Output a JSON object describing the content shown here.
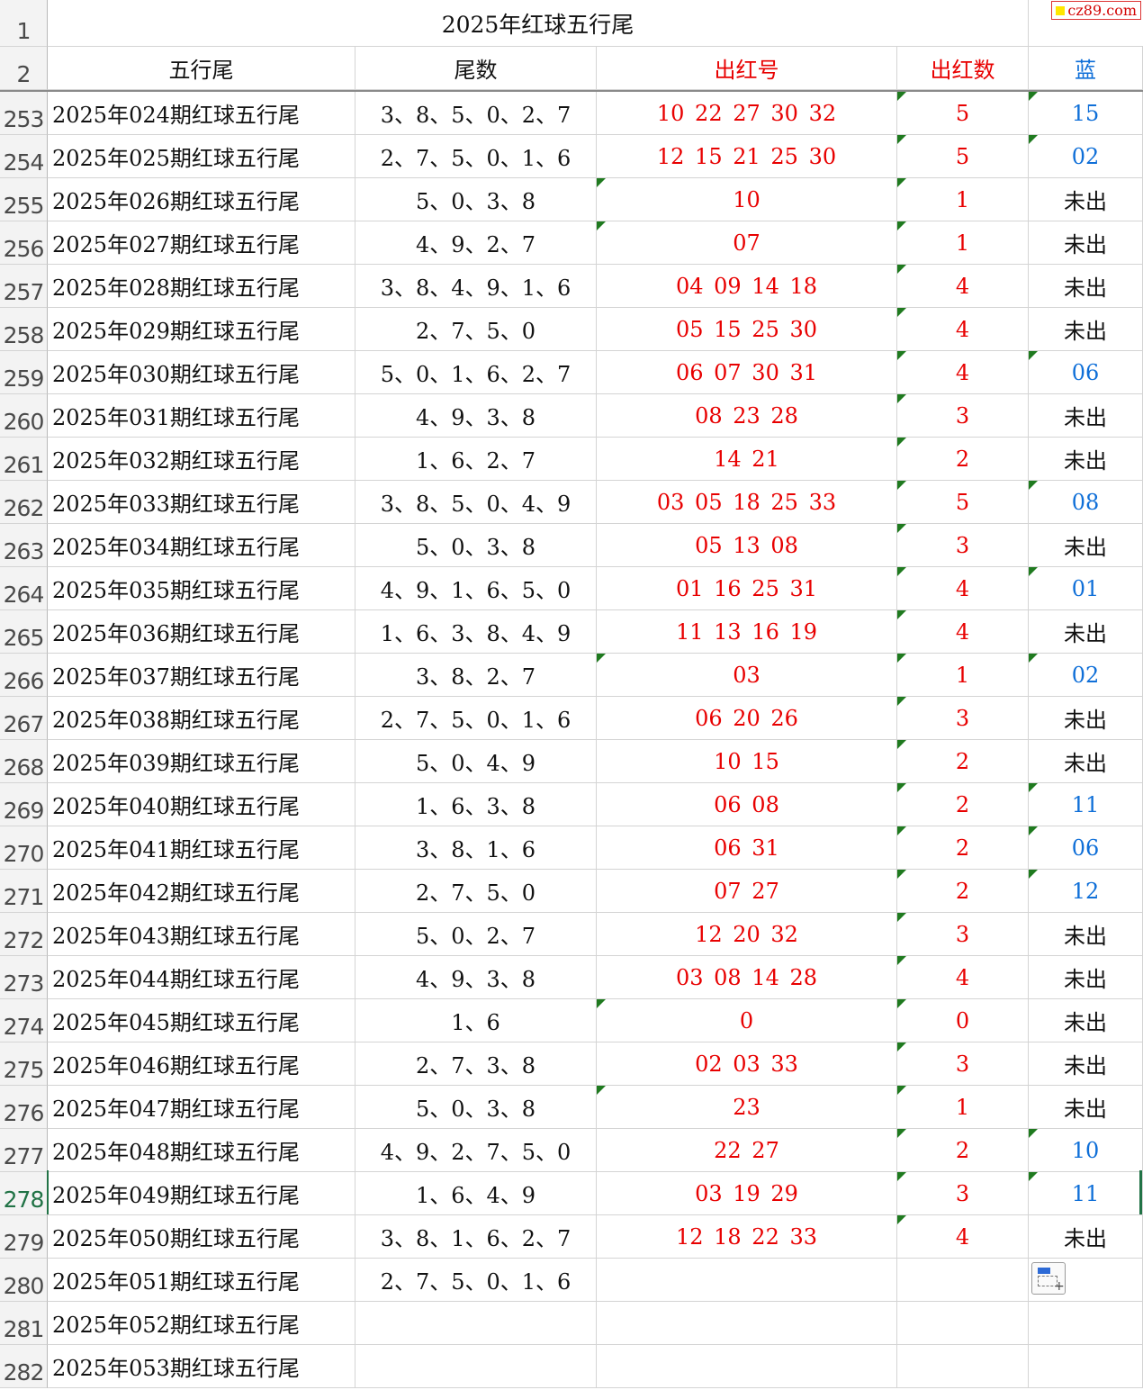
{
  "watermark": "cz89.com",
  "title_row": {
    "row_number": "1",
    "title": "2025年红球五行尾"
  },
  "header_row": {
    "row_number": "2",
    "col_wuxingwei": "五行尾",
    "col_weishu": "尾数",
    "col_chuhonghao": "出红号",
    "col_chuhongshu": "出红数",
    "col_lan": "蓝"
  },
  "rows": [
    {
      "n": "253",
      "name": "2025年024期红球五行尾",
      "tails": "3、8、5、0、2、7",
      "reds": "10 22 27 30 32",
      "count": "5",
      "blue": "15",
      "blue_hit": true,
      "tri_red": false,
      "tri_count": true,
      "tri_blue": true
    },
    {
      "n": "254",
      "name": "2025年025期红球五行尾",
      "tails": "2、7、5、0、1、6",
      "reds": "12 15 21 25 30",
      "count": "5",
      "blue": "02",
      "blue_hit": true,
      "tri_red": false,
      "tri_count": true,
      "tri_blue": true
    },
    {
      "n": "255",
      "name": "2025年026期红球五行尾",
      "tails": "5、0、3、8",
      "reds": "10",
      "count": "1",
      "blue": "未出",
      "blue_hit": false,
      "tri_red": true,
      "tri_count": true,
      "tri_blue": false
    },
    {
      "n": "256",
      "name": "2025年027期红球五行尾",
      "tails": "4、9、2、7",
      "reds": "07",
      "count": "1",
      "blue": "未出",
      "blue_hit": false,
      "tri_red": true,
      "tri_count": true,
      "tri_blue": false
    },
    {
      "n": "257",
      "name": "2025年028期红球五行尾",
      "tails": "3、8、4、9、1、6",
      "reds": "04 09 14 18",
      "count": "4",
      "blue": "未出",
      "blue_hit": false,
      "tri_red": false,
      "tri_count": true,
      "tri_blue": false
    },
    {
      "n": "258",
      "name": "2025年029期红球五行尾",
      "tails": "2、7、5、0",
      "reds": "05 15 25 30",
      "count": "4",
      "blue": "未出",
      "blue_hit": false,
      "tri_red": false,
      "tri_count": true,
      "tri_blue": false
    },
    {
      "n": "259",
      "name": "2025年030期红球五行尾",
      "tails": "5、0、1、6、2、7",
      "reds": "06 07 30 31",
      "count": "4",
      "blue": "06",
      "blue_hit": true,
      "tri_red": false,
      "tri_count": true,
      "tri_blue": true
    },
    {
      "n": "260",
      "name": "2025年031期红球五行尾",
      "tails": "4、9、3、8",
      "reds": "08 23 28",
      "count": "3",
      "blue": "未出",
      "blue_hit": false,
      "tri_red": false,
      "tri_count": true,
      "tri_blue": false
    },
    {
      "n": "261",
      "name": "2025年032期红球五行尾",
      "tails": "1、6、2、7",
      "reds": "14 21",
      "count": "2",
      "blue": "未出",
      "blue_hit": false,
      "tri_red": false,
      "tri_count": true,
      "tri_blue": false
    },
    {
      "n": "262",
      "name": "2025年033期红球五行尾",
      "tails": "3、8、5、0、4、9",
      "reds": "03 05 18 25 33",
      "count": "5",
      "blue": "08",
      "blue_hit": true,
      "tri_red": false,
      "tri_count": true,
      "tri_blue": true
    },
    {
      "n": "263",
      "name": "2025年034期红球五行尾",
      "tails": "5、0、3、8",
      "reds": "05 13 08",
      "count": "3",
      "blue": "未出",
      "blue_hit": false,
      "tri_red": false,
      "tri_count": true,
      "tri_blue": false
    },
    {
      "n": "264",
      "name": "2025年035期红球五行尾",
      "tails": "4、9、1、6、5、0",
      "reds": "01 16 25 31",
      "count": "4",
      "blue": "01",
      "blue_hit": true,
      "tri_red": false,
      "tri_count": true,
      "tri_blue": true
    },
    {
      "n": "265",
      "name": "2025年036期红球五行尾",
      "tails": "1、6、3、8、4、9",
      "reds": "11 13 16 19",
      "count": "4",
      "blue": "未出",
      "blue_hit": false,
      "tri_red": false,
      "tri_count": true,
      "tri_blue": false
    },
    {
      "n": "266",
      "name": "2025年037期红球五行尾",
      "tails": "3、8、2、7",
      "reds": "03",
      "count": "1",
      "blue": "02",
      "blue_hit": true,
      "tri_red": true,
      "tri_count": true,
      "tri_blue": true
    },
    {
      "n": "267",
      "name": "2025年038期红球五行尾",
      "tails": "2、7、5、0、1、6",
      "reds": "06 20 26",
      "count": "3",
      "blue": "未出",
      "blue_hit": false,
      "tri_red": false,
      "tri_count": true,
      "tri_blue": false
    },
    {
      "n": "268",
      "name": "2025年039期红球五行尾",
      "tails": "5、0、4、9",
      "reds": "10 15",
      "count": "2",
      "blue": "未出",
      "blue_hit": false,
      "tri_red": false,
      "tri_count": true,
      "tri_blue": false
    },
    {
      "n": "269",
      "name": "2025年040期红球五行尾",
      "tails": "1、6、3、8",
      "reds": "06 08",
      "count": "2",
      "blue": "11",
      "blue_hit": true,
      "tri_red": false,
      "tri_count": true,
      "tri_blue": true
    },
    {
      "n": "270",
      "name": "2025年041期红球五行尾",
      "tails": "3、8、1、6",
      "reds": "06 31",
      "count": "2",
      "blue": "06",
      "blue_hit": true,
      "tri_red": false,
      "tri_count": true,
      "tri_blue": true
    },
    {
      "n": "271",
      "name": "2025年042期红球五行尾",
      "tails": "2、7、5、0",
      "reds": "07 27",
      "count": "2",
      "blue": "12",
      "blue_hit": true,
      "tri_red": false,
      "tri_count": true,
      "tri_blue": true
    },
    {
      "n": "272",
      "name": "2025年043期红球五行尾",
      "tails": "5、0、2、7",
      "reds": "12 20 32",
      "count": "3",
      "blue": "未出",
      "blue_hit": false,
      "tri_red": false,
      "tri_count": true,
      "tri_blue": false
    },
    {
      "n": "273",
      "name": "2025年044期红球五行尾",
      "tails": "4、9、3、8",
      "reds": "03 08 14 28",
      "count": "4",
      "blue": "未出",
      "blue_hit": false,
      "tri_red": false,
      "tri_count": true,
      "tri_blue": false
    },
    {
      "n": "274",
      "name": "2025年045期红球五行尾",
      "tails": "1、6",
      "reds": "0",
      "count": "0",
      "blue": "未出",
      "blue_hit": false,
      "tri_red": true,
      "tri_count": true,
      "tri_blue": false
    },
    {
      "n": "275",
      "name": "2025年046期红球五行尾",
      "tails": "2、7、3、8",
      "reds": "02 03 33",
      "count": "3",
      "blue": "未出",
      "blue_hit": false,
      "tri_red": false,
      "tri_count": true,
      "tri_blue": false
    },
    {
      "n": "276",
      "name": "2025年047期红球五行尾",
      "tails": "5、0、3、8",
      "reds": "23",
      "count": "1",
      "blue": "未出",
      "blue_hit": false,
      "tri_red": true,
      "tri_count": true,
      "tri_blue": false
    },
    {
      "n": "277",
      "name": "2025年048期红球五行尾",
      "tails": "4、9、2、7、5、0",
      "reds": "22 27",
      "count": "2",
      "blue": "10",
      "blue_hit": true,
      "tri_red": false,
      "tri_count": true,
      "tri_blue": true
    },
    {
      "n": "278",
      "name": "2025年049期红球五行尾",
      "tails": "1、6、4、9",
      "reds": "03 19 29",
      "count": "3",
      "blue": "11",
      "blue_hit": true,
      "tri_red": false,
      "tri_count": true,
      "tri_blue": true,
      "active": true
    },
    {
      "n": "279",
      "name": "2025年050期红球五行尾",
      "tails": "3、8、1、6、2、7",
      "reds": "12 18 22 33",
      "count": "4",
      "blue": "未出",
      "blue_hit": false,
      "tri_red": false,
      "tri_count": true,
      "tri_blue": false
    },
    {
      "n": "280",
      "name": "2025年051期红球五行尾",
      "tails": "2、7、5、0、1、6",
      "reds": "",
      "count": "",
      "blue": "",
      "blue_hit": false,
      "tri_red": false,
      "tri_count": false,
      "tri_blue": false
    },
    {
      "n": "281",
      "name": "2025年052期红球五行尾",
      "tails": "",
      "reds": "",
      "count": "",
      "blue": "",
      "blue_hit": false,
      "tri_red": false,
      "tri_count": false,
      "tri_blue": false
    },
    {
      "n": "282",
      "name": "2025年053期红球五行尾",
      "tails": "",
      "reds": "",
      "count": "",
      "blue": "",
      "blue_hit": false,
      "tri_red": false,
      "tri_count": false,
      "tri_blue": false
    }
  ],
  "colors": {
    "red_text": "#e80000",
    "blue_text": "#0f6fd8",
    "comment_triangle": "#1f7a1f",
    "selection": "#217346"
  },
  "icons": {
    "paste_options": "paste-options-icon"
  }
}
